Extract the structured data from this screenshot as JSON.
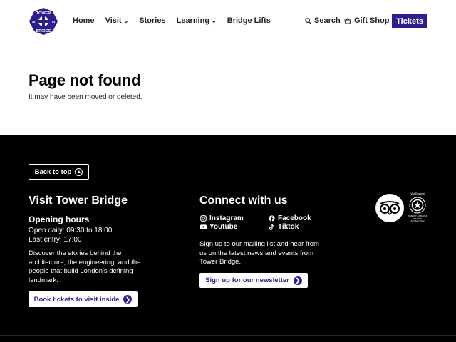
{
  "header": {
    "logo_text": [
      "TOWER",
      "BRIDGE",
      "18",
      "94"
    ],
    "nav": [
      {
        "label": "Home",
        "dropdown": false
      },
      {
        "label": "Visit",
        "dropdown": true
      },
      {
        "label": "Stories",
        "dropdown": false
      },
      {
        "label": "Learning",
        "dropdown": true
      },
      {
        "label": "Bridge Lifts",
        "dropdown": false
      }
    ],
    "search_label": "Search",
    "gift_label": "Gift Shop",
    "tickets_label": "Tickets"
  },
  "main": {
    "title": "Page not found",
    "subtitle": "It may have been moved or deleted."
  },
  "footer": {
    "back_to_top": "Back to top",
    "visit_title": "Visit Tower Bridge",
    "hours_title": "Opening hours",
    "hours_lines": [
      "Open daily: 09:30 to 18:00",
      "Last entry: 17:00"
    ],
    "discover": "Discover the stories behind the architecture, the engineering, and the people that build London's defining landmark.",
    "book_button": "Book tickets to visit inside",
    "connect_title": "Connect with us",
    "socials": [
      {
        "label": "Instagram",
        "icon": "instagram-icon"
      },
      {
        "label": "Facebook",
        "icon": "facebook-icon"
      },
      {
        "label": "Youtube",
        "icon": "youtube-icon"
      },
      {
        "label": "Tiktok",
        "icon": "tiktok-icon"
      }
    ],
    "signup_text": "Sign up to our mailing list and hear from us on the latest news and events from Tower Bridge.",
    "newsletter_button": "Sign up for our newsletter",
    "visit_england_top": "VisitEngland",
    "visit_england_bottom": "QUALITY ASSURED VISITOR ATTRACTION"
  },
  "colors": {
    "brand": "#2c1e8c",
    "footer_bg": "#000000",
    "text": "#111111"
  }
}
